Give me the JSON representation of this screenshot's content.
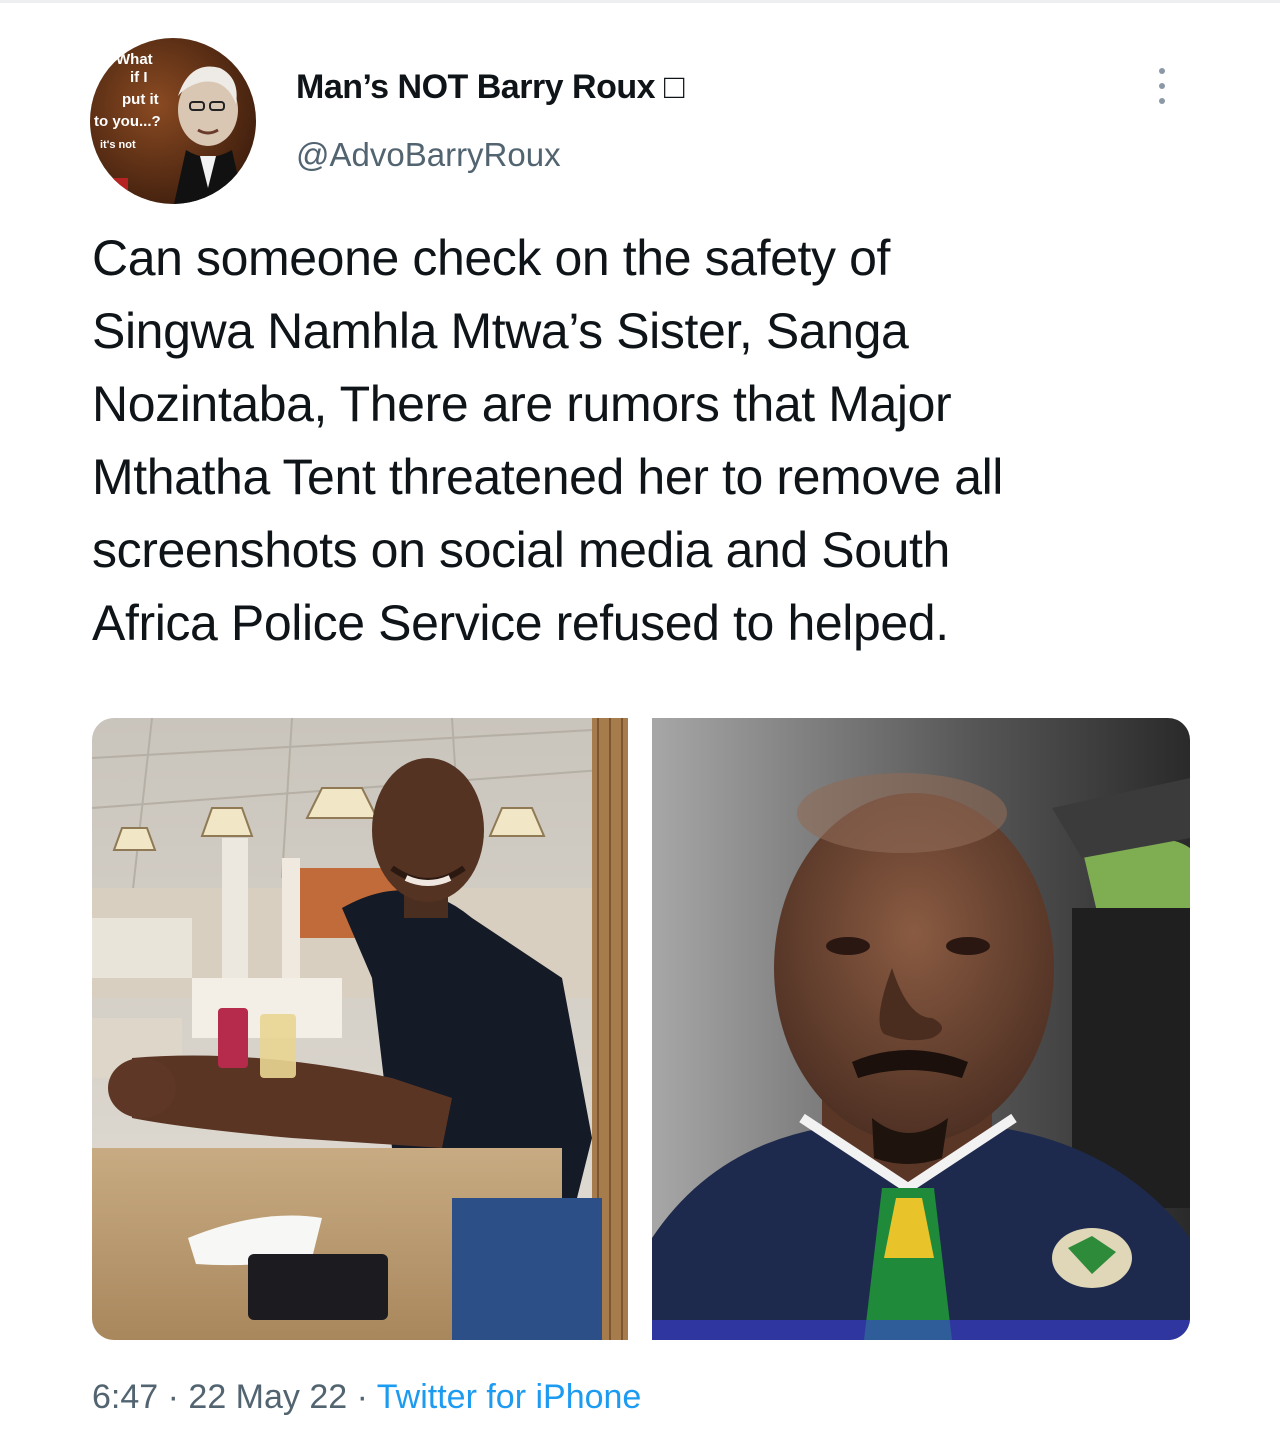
{
  "tweet": {
    "author": {
      "display_name": "Man’s NOT Barry Roux □",
      "handle": "@AdvoBarryRoux",
      "avatar_caption": [
        "What",
        "if I",
        "put it",
        "to you...?",
        "it's not"
      ]
    },
    "text_lines": [
      "Can someone check on the safety of",
      "Singwa Namhla Mtwa’s Sister,  Sanga",
      "Nozintaba, There are rumors that Major",
      "Mthatha Tent threatened her to remove all",
      "screenshots on social media and South",
      "Africa Police Service refused to helped."
    ],
    "media": [
      {
        "subject": "man seated at restaurant table"
      },
      {
        "subject": "man in car selfie"
      }
    ],
    "meta": {
      "time": "6:47",
      "separator": " · ",
      "date": "22 May 22",
      "source": "Twitter for iPhone"
    }
  },
  "icons": {
    "more": "more-vertical-icon"
  },
  "colors": {
    "text": "#0f1419",
    "secondary": "#536471",
    "link": "#1d9bf0"
  }
}
